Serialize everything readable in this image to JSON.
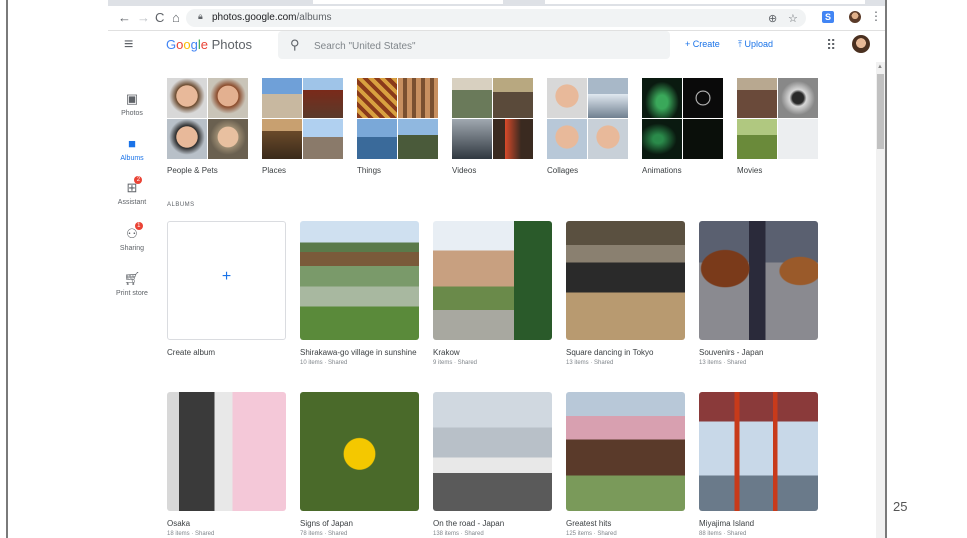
{
  "browser": {
    "url_host": "photos.google.com",
    "url_path": "/albums",
    "s_label": "S"
  },
  "header": {
    "logo_google": [
      "G",
      "o",
      "o",
      "g",
      "l",
      "e"
    ],
    "logo_photos": "Photos",
    "search_placeholder": "Search \"United States\"",
    "create_label": "+ Create",
    "upload_label": "Upload"
  },
  "sidebar": {
    "items": [
      {
        "label": "Photos",
        "badge": ""
      },
      {
        "label": "Albums",
        "badge": ""
      },
      {
        "label": "Assistant",
        "badge": "2"
      },
      {
        "label": "Sharing",
        "badge": "1"
      },
      {
        "label": "Print store",
        "badge": ""
      }
    ]
  },
  "categories": [
    {
      "label": "People & Pets"
    },
    {
      "label": "Places"
    },
    {
      "label": "Things"
    },
    {
      "label": "Videos"
    },
    {
      "label": "Collages"
    },
    {
      "label": "Animations"
    },
    {
      "label": "Movies"
    }
  ],
  "albums_section_title": "ALBUMS",
  "create_album_label": "Create album",
  "albums": [
    {
      "title": "Shirakawa-go village in sunshine",
      "meta": "10 items · Shared"
    },
    {
      "title": "Krakow",
      "meta": "9 items · Shared"
    },
    {
      "title": "Square dancing in Tokyo",
      "meta": "13 items · Shared"
    },
    {
      "title": "Souvenirs - Japan",
      "meta": "13 items · Shared"
    },
    {
      "title": "Osaka",
      "meta": "18 items · Shared"
    },
    {
      "title": "Signs of Japan",
      "meta": "78 items · Shared"
    },
    {
      "title": "On the road - Japan",
      "meta": "138 items · Shared"
    },
    {
      "title": "Greatest hits",
      "meta": "125 items · Shared"
    },
    {
      "title": "Miyajima Island",
      "meta": "88 items · Shared"
    }
  ],
  "page_number": "25"
}
